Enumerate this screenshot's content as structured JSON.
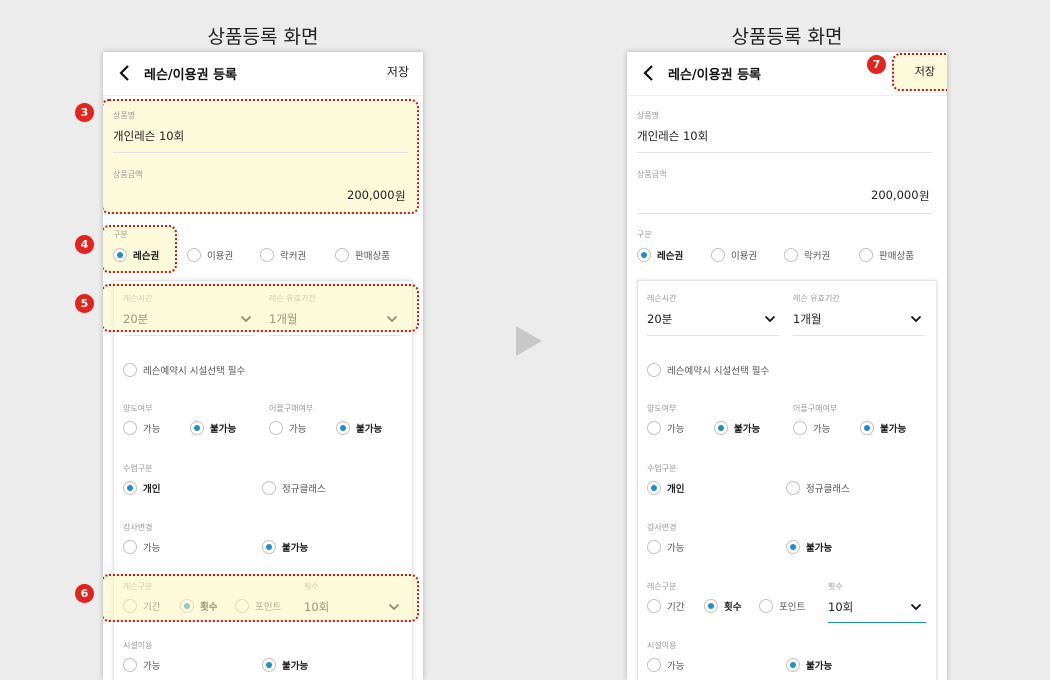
{
  "screens": [
    {
      "title": "상품등록 화면"
    },
    {
      "title": "상품등록 화면"
    }
  ],
  "app": {
    "back_icon": "chevron-left-icon",
    "title": "레슨/이용권 등록",
    "save_label": "저장"
  },
  "form": {
    "product_name": {
      "label": "상품명",
      "value": "개인레슨 10회"
    },
    "product_price": {
      "label": "상품금액",
      "value": "200,000",
      "unit": "원"
    },
    "category": {
      "label": "구분",
      "options": [
        "레슨권",
        "이용권",
        "락커권",
        "판매상품"
      ],
      "selected": "레슨권"
    },
    "lesson_time": {
      "label": "레슨시간",
      "value": "20분"
    },
    "lesson_validity": {
      "label": "레슨 유효기간",
      "value": "1개월"
    },
    "facility_required": {
      "label": "레슨예약시 시설선택 필수",
      "checked": false
    },
    "transfer": {
      "label": "양도여부",
      "options": [
        "가능",
        "불가능"
      ],
      "selected": "불가능"
    },
    "goods_purchase": {
      "label": "어플구매여부",
      "options": [
        "가능",
        "불가능"
      ],
      "selected": "불가능"
    },
    "class_type": {
      "label": "수업구분",
      "options": [
        "개인",
        "정규클래스"
      ],
      "selected": "개인"
    },
    "instructor_change": {
      "label": "강사변경",
      "options": [
        "가능",
        "불가능"
      ],
      "selected": "불가능"
    },
    "lesson_type": {
      "label": "레슨구분",
      "options": [
        "기간",
        "횟수",
        "포인트"
      ],
      "selected": "횟수"
    },
    "count": {
      "label": "횟수",
      "value": "10회"
    },
    "facility_use": {
      "label": "시설이용",
      "options": [
        "가능",
        "불가능"
      ],
      "selected": "불가능"
    }
  },
  "annotations": [
    "3",
    "4",
    "5",
    "6",
    "7"
  ],
  "colors": {
    "accent": "#1b8fd3",
    "highlight_border": "#c8161a",
    "highlight_fill": "#faf5be",
    "badge": "#e5231e"
  }
}
